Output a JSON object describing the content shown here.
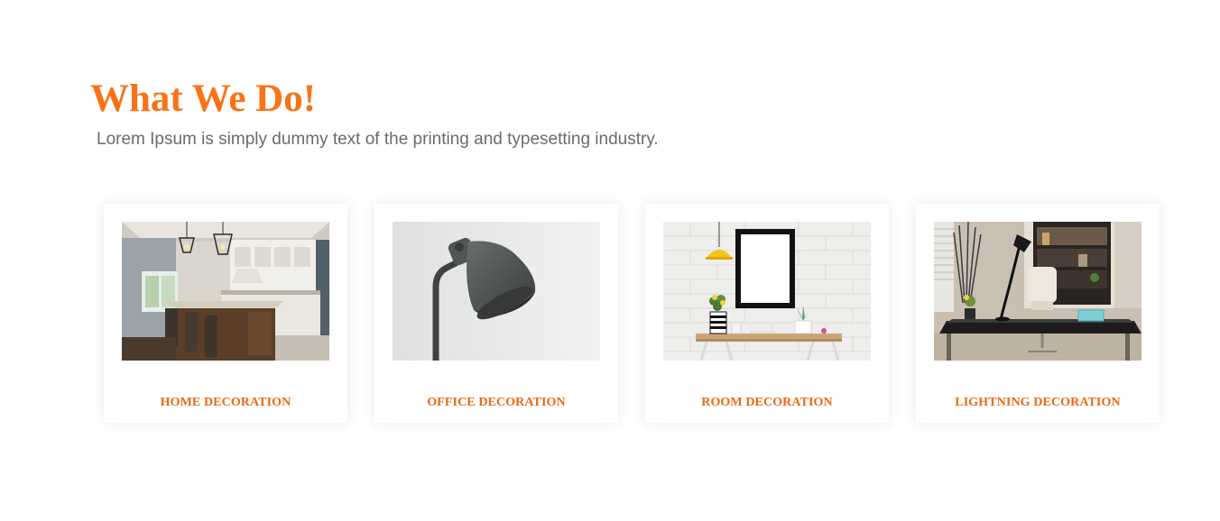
{
  "section": {
    "title": "What We Do!",
    "subtitle": "Lorem Ipsum is simply dummy text of the printing and typesetting industry."
  },
  "cards": [
    {
      "label": "HOME DECORATION",
      "image": "kitchen-photo"
    },
    {
      "label": "OFFICE DECORATION",
      "image": "desk-lamp-photo"
    },
    {
      "label": "ROOM DECORATION",
      "image": "wall-desk-photo"
    },
    {
      "label": "LIGHTNING DECORATION",
      "image": "office-desk-lamp-photo"
    }
  ],
  "colors": {
    "accent": "#f97316",
    "subtitle": "#6b6b6b",
    "background": "#ffffff"
  }
}
